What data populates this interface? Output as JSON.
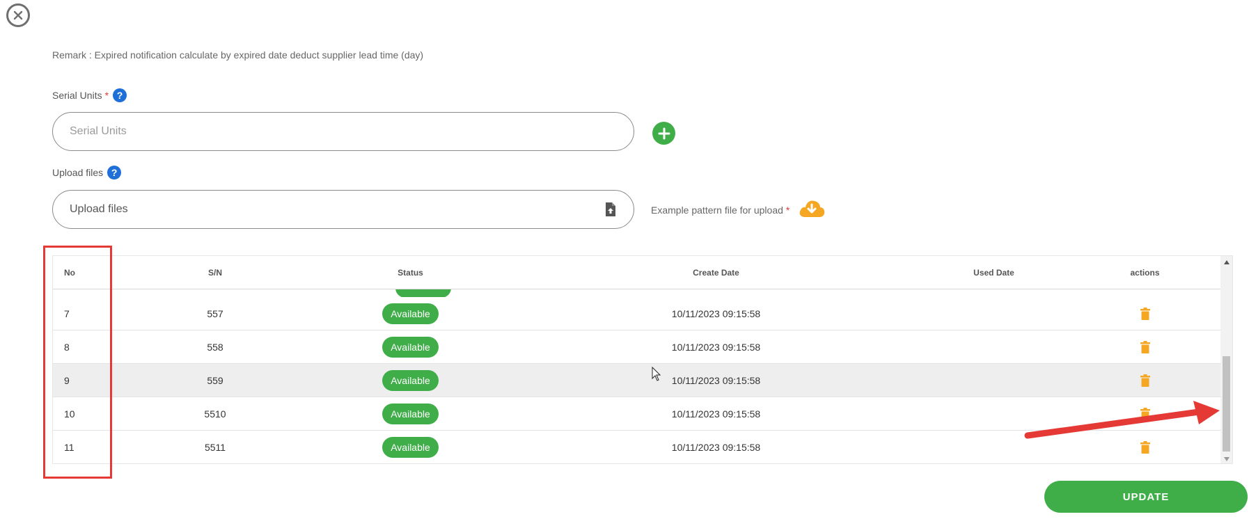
{
  "dialog": {
    "remark": "Remark : Expired notification calculate by expired date deduct supplier lead time (day)"
  },
  "serial_units": {
    "label": "Serial Units",
    "required_mark": "*",
    "placeholder": "Serial Units",
    "value": ""
  },
  "upload": {
    "label": "Upload files",
    "field_text": "Upload files",
    "example_label": "Example pattern file for upload",
    "required_mark": "*"
  },
  "table": {
    "headers": {
      "no": "No",
      "sn": "S/N",
      "status": "Status",
      "create_date": "Create Date",
      "used_date": "Used Date",
      "actions": "actions"
    },
    "rows": [
      {
        "no": "7",
        "sn": "557",
        "status": "Available",
        "create_date": "10/11/2023 09:15:58",
        "used_date": ""
      },
      {
        "no": "8",
        "sn": "558",
        "status": "Available",
        "create_date": "10/11/2023 09:15:58",
        "used_date": ""
      },
      {
        "no": "9",
        "sn": "559",
        "status": "Available",
        "create_date": "10/11/2023 09:15:58",
        "used_date": ""
      },
      {
        "no": "10",
        "sn": "5510",
        "status": "Available",
        "create_date": "10/11/2023 09:15:58",
        "used_date": ""
      },
      {
        "no": "11",
        "sn": "5511",
        "status": "Available",
        "create_date": "10/11/2023 09:15:58",
        "used_date": ""
      }
    ]
  },
  "buttons": {
    "update": "UPDATE"
  },
  "icons": {
    "close": "close-icon",
    "help": "question-icon",
    "add": "plus-icon",
    "file_upload": "file-upload-icon",
    "cloud_download": "cloud-download-icon",
    "delete": "trash-icon"
  },
  "colors": {
    "primary_green": "#3fae49",
    "help_blue": "#1e6fd8",
    "trash_orange": "#f5a623",
    "annotation_red": "#e53935"
  }
}
